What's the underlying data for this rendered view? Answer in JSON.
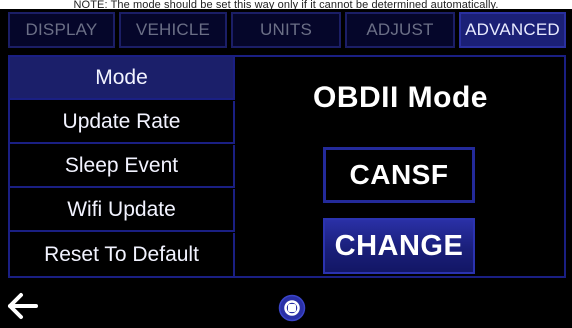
{
  "caption": "NOTE: The mode should be set this way only if it cannot be determined automatically.",
  "tabs": [
    {
      "label": "DISPLAY",
      "active": false
    },
    {
      "label": "VEHICLE",
      "active": false
    },
    {
      "label": "UNITS",
      "active": false
    },
    {
      "label": "ADJUST",
      "active": false
    },
    {
      "label": "ADVANCED",
      "active": true
    }
  ],
  "menu": {
    "items": [
      {
        "label": "Mode",
        "selected": true
      },
      {
        "label": "Update Rate",
        "selected": false
      },
      {
        "label": "Sleep Event",
        "selected": false
      },
      {
        "label": "Wifi Update",
        "selected": false
      },
      {
        "label": "Reset To Default",
        "selected": false
      }
    ]
  },
  "content": {
    "title": "OBDII Mode",
    "value": "CANSF",
    "change_label": "CHANGE"
  },
  "icons": {
    "back": "back-arrow-icon",
    "home": "home-circle-icon"
  },
  "colors": {
    "accent": "#1b2076",
    "border": "#1a1f83",
    "background": "#000000"
  }
}
